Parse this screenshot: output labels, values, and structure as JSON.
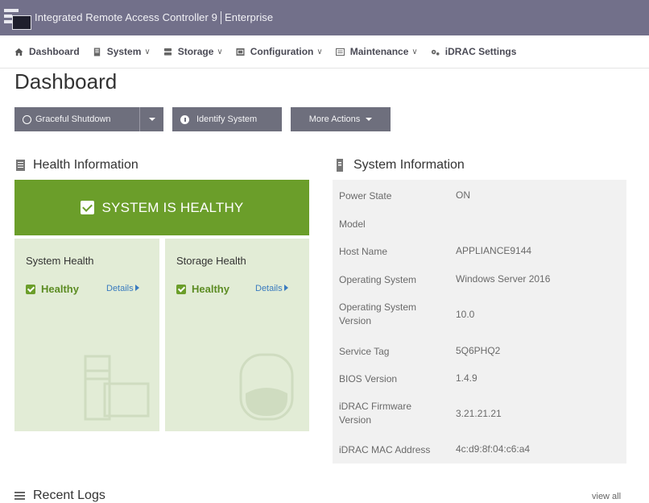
{
  "header": {
    "title": "Integrated Remote Access Controller 9",
    "edition": "Enterprise"
  },
  "nav": {
    "items": [
      {
        "label": "Dashboard",
        "icon": "home-icon"
      },
      {
        "label": "System",
        "icon": "server-icon"
      },
      {
        "label": "Storage",
        "icon": "storage-icon"
      },
      {
        "label": "Configuration",
        "icon": "config-icon"
      },
      {
        "label": "Maintenance",
        "icon": "maintenance-icon"
      },
      {
        "label": "iDRAC Settings",
        "icon": "settings-icon"
      }
    ]
  },
  "page": {
    "title": "Dashboard"
  },
  "actions": {
    "graceful_shutdown": "Graceful Shutdown",
    "identify_system": "Identify System",
    "more_actions": "More Actions"
  },
  "health": {
    "title": "Health Information",
    "banner": "SYSTEM IS HEALTHY",
    "system_health": {
      "title": "System Health",
      "status": "Healthy",
      "details": "Details"
    },
    "storage_health": {
      "title": "Storage Health",
      "status": "Healthy",
      "details": "Details"
    },
    "colors": {
      "ok": "#6b9e2a",
      "panel": "#e2ecd6"
    }
  },
  "system_info": {
    "title": "System Information",
    "rows": [
      {
        "label": "Power State",
        "value": "ON"
      },
      {
        "label": "Model",
        "value": ""
      },
      {
        "label": "Host Name",
        "value": "APPLIANCE9144"
      },
      {
        "label": "Operating System",
        "value": "Windows Server 2016"
      },
      {
        "label": "Operating System Version",
        "value": "10.0"
      },
      {
        "label": "Service Tag",
        "value": "5Q6PHQ2"
      },
      {
        "label": "BIOS Version",
        "value": "1.4.9"
      },
      {
        "label": "iDRAC Firmware Version",
        "value": "3.21.21.21"
      },
      {
        "label": "iDRAC MAC Address",
        "value": "4c:d9:8f:04:c6:a4"
      }
    ]
  },
  "logs": {
    "title": "Recent Logs",
    "view_all": "view all"
  }
}
